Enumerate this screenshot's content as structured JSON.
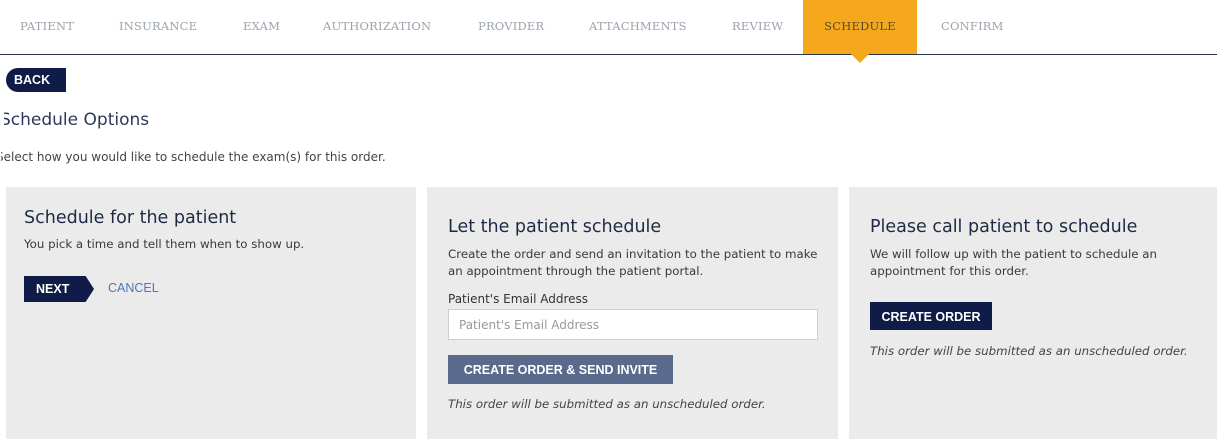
{
  "steps": [
    {
      "label": "PATIENT",
      "active": false
    },
    {
      "label": "INSURANCE",
      "active": false
    },
    {
      "label": "EXAM",
      "active": false
    },
    {
      "label": "AUTHORIZATION",
      "active": false
    },
    {
      "label": "PROVIDER",
      "active": false
    },
    {
      "label": "ATTACHMENTS",
      "active": false
    },
    {
      "label": "REVIEW",
      "active": false
    },
    {
      "label": "SCHEDULE",
      "active": true
    },
    {
      "label": "CONFIRM",
      "active": false
    }
  ],
  "back_label": "BACK",
  "page": {
    "title": "Schedule Options",
    "subtitle": "Select how you would like to schedule the exam(s) for this order."
  },
  "options": {
    "self_schedule": {
      "title": "Schedule for the patient",
      "description": "You pick a time and tell them when to show up.",
      "next_label": "NEXT",
      "cancel_label": "CANCEL"
    },
    "patient_schedule": {
      "title": "Let the patient schedule",
      "description": "Create the order and send an invitation to the patient to make an appointment through the patient portal.",
      "email_label": "Patient's Email Address",
      "email_value": "",
      "email_placeholder": "Patient's Email Address",
      "button_label": "CREATE ORDER & SEND INVITE",
      "note": "This order will be submitted as an unscheduled order."
    },
    "call_patient": {
      "title": "Please call patient to schedule",
      "description": "We will follow up with the patient to schedule an appointment for this order.",
      "button_label": "CREATE ORDER",
      "note": "This order will be submitted as an unscheduled order."
    }
  },
  "colors": {
    "active_step": "#f5a81c",
    "primary_button": "#0f1c48",
    "secondary_button": "#5a6a8c",
    "panel_bg": "#ebebeb",
    "link": "#4a7ab5"
  }
}
